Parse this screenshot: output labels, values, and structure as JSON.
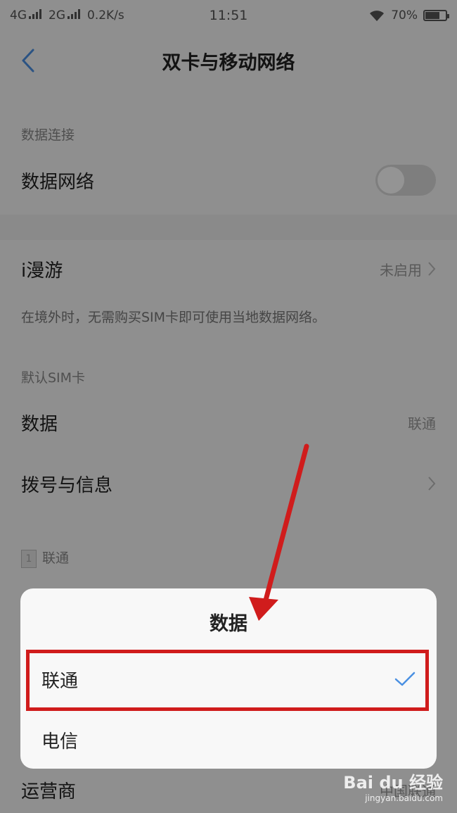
{
  "status_bar": {
    "sim1_net": "4G",
    "sim2_net": "2G",
    "speed": "0.2K/s",
    "time": "11:51",
    "battery": "70%",
    "battery_level": 0.7
  },
  "header": {
    "title": "双卡与移动网络"
  },
  "sections": {
    "data_connection": "数据连接",
    "default_sim": "默认SIM卡",
    "sim1_header": "联通"
  },
  "rows": {
    "data_network": {
      "label": "数据网络",
      "toggle": "off"
    },
    "roaming": {
      "label": "i漫游",
      "value": "未启用",
      "desc": "在境外时，无需购买SIM卡即可使用当地数据网络。"
    },
    "data": {
      "label": "数据",
      "value": "联通"
    },
    "dial": {
      "label": "拨号与信息"
    },
    "carrier": {
      "label": "运营商",
      "value": "中国联通"
    }
  },
  "dialog": {
    "title": "数据",
    "options": [
      {
        "label": "联通",
        "selected": true
      },
      {
        "label": "电信",
        "selected": false
      }
    ]
  },
  "watermark": {
    "logo": "Bai du 经验",
    "url": "jingyan.baidu.com"
  },
  "colors": {
    "accent": "#4a90e2",
    "annotation_red": "#d01c1c",
    "overlay": "rgba(0,0,0,0.42)"
  }
}
